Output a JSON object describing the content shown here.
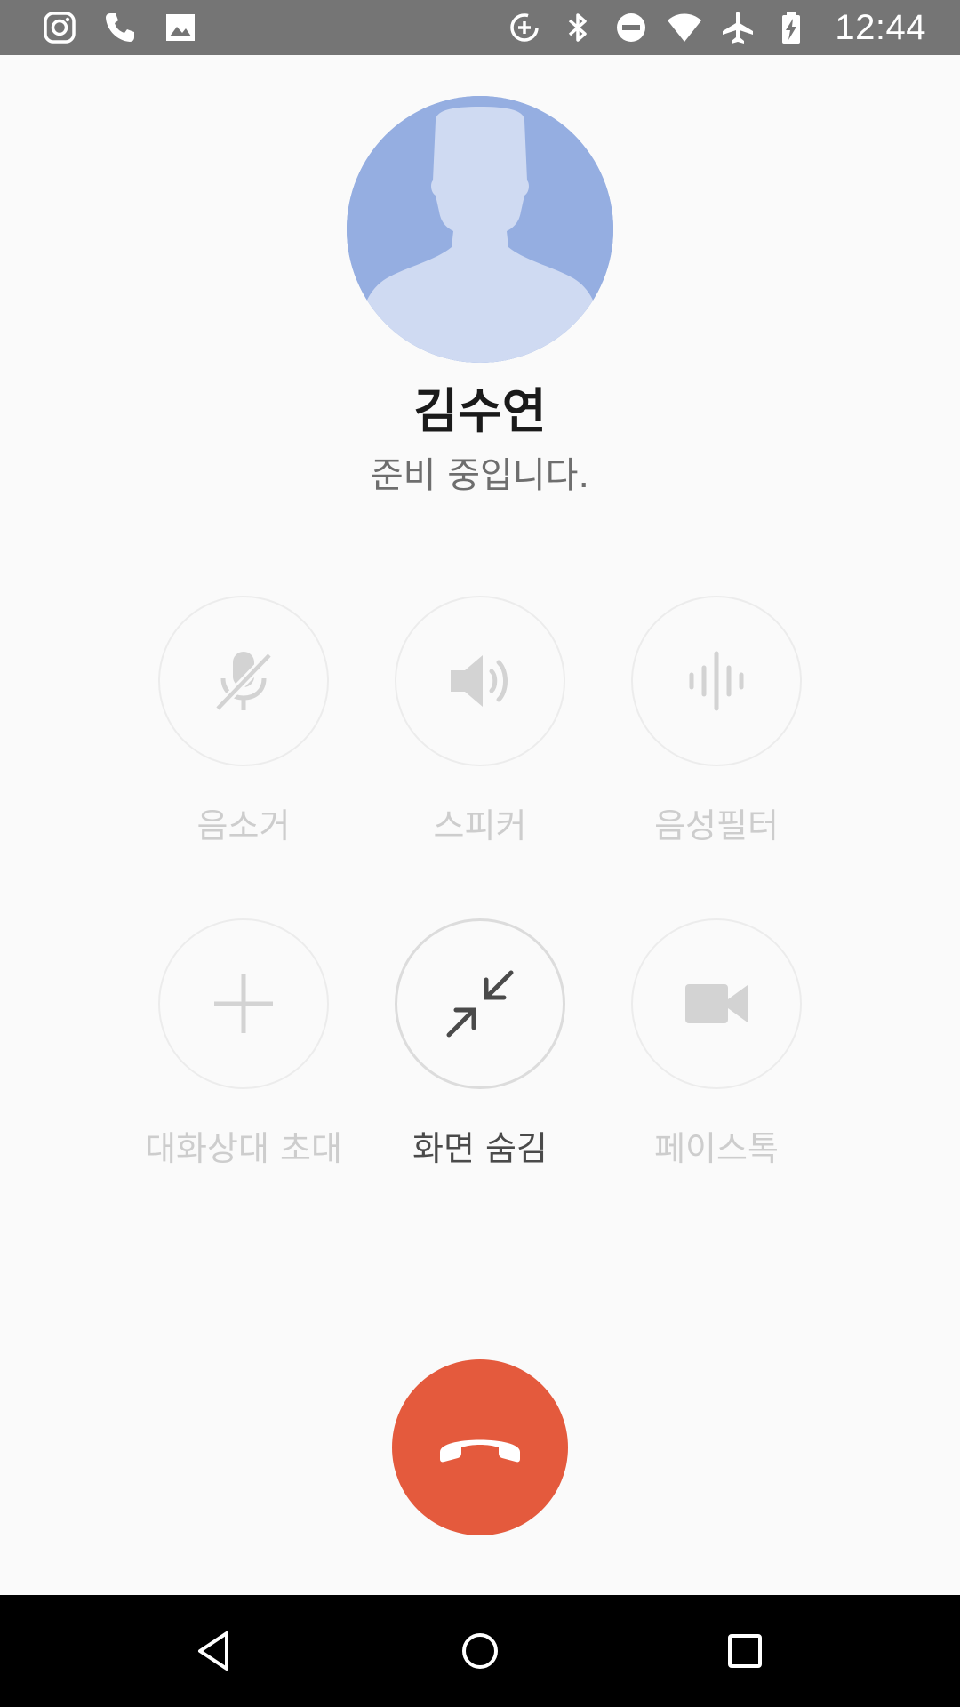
{
  "status_bar": {
    "left_icons": [
      "instagram-icon",
      "phone-icon",
      "image-icon"
    ],
    "right_icons": [
      "data-saver-icon",
      "bluetooth-icon",
      "do-not-disturb-icon",
      "wifi-icon",
      "airplane-icon",
      "battery-charging-icon"
    ],
    "time": "12:44",
    "background": "#757575"
  },
  "caller": {
    "name": "김수연",
    "status": "준비 중입니다.",
    "avatar_bg": "#95aee1",
    "avatar_fg": "#cfdaf2"
  },
  "controls": [
    {
      "id": "mute",
      "label": "음소거",
      "icon": "mic-off-icon",
      "enabled": false
    },
    {
      "id": "speaker",
      "label": "스피커",
      "icon": "speaker-icon",
      "enabled": false
    },
    {
      "id": "voice-filter",
      "label": "음성필터",
      "icon": "voice-filter-icon",
      "enabled": false
    },
    {
      "id": "invite",
      "label": "대화상대 초대",
      "icon": "plus-icon",
      "enabled": false
    },
    {
      "id": "hide-screen",
      "label": "화면 숨김",
      "icon": "minimize-icon",
      "enabled": true
    },
    {
      "id": "facetalk",
      "label": "페이스톡",
      "icon": "video-camera-icon",
      "enabled": false
    }
  ],
  "end_call": {
    "icon": "end-call-icon",
    "color": "#e45a3d"
  },
  "nav_bar": {
    "buttons": [
      "back-icon",
      "home-icon",
      "recents-icon"
    ]
  }
}
